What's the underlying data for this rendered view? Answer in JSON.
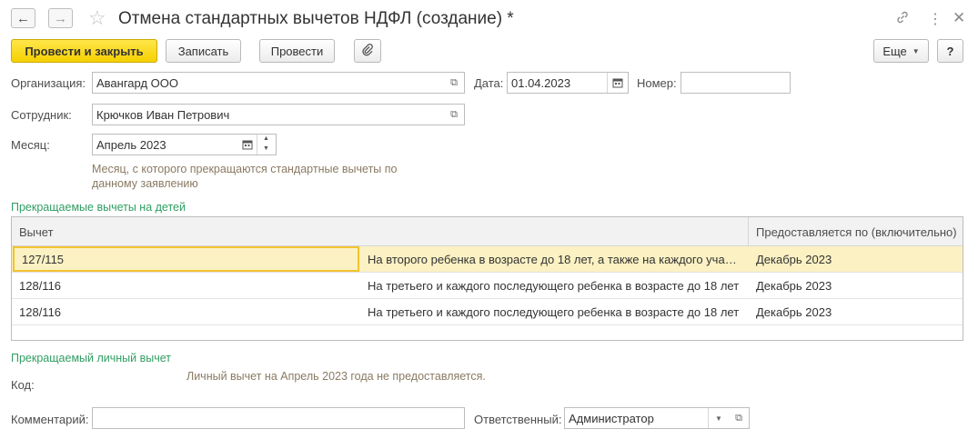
{
  "window": {
    "title": "Отмена стандартных вычетов НДФЛ (создание) *"
  },
  "toolbar": {
    "post_close_label": "Провести и закрыть",
    "save_label": "Записать",
    "post_label": "Провести",
    "more_label": "Еще",
    "help_label": "?"
  },
  "form": {
    "organization_label": "Организация:",
    "organization_value": "Авангард ООО",
    "date_label": "Дата:",
    "date_value": "01.04.2023",
    "number_label": "Номер:",
    "number_value": "",
    "employee_label": "Сотрудник:",
    "employee_value": "Крючков Иван Петрович",
    "month_label": "Месяц:",
    "month_value": "Апрель 2023",
    "month_hint": "Месяц, с которого прекращаются стандартные вычеты по данному заявлению"
  },
  "children_section": {
    "title": "Прекращаемые вычеты на детей",
    "columns": [
      "Вычет",
      "Предоставляется по (включительно)"
    ],
    "rows": [
      {
        "code": "127/115",
        "description": "На второго ребенка в возрасте до 18 лет, а также на каждого учащегося очной формы обучения",
        "until": "Декабрь 2023"
      },
      {
        "code": "128/116",
        "description": "На третьего и каждого последующего ребенка в возрасте до 18 лет",
        "until": "Декабрь 2023"
      },
      {
        "code": "128/116",
        "description": "На третьего и каждого последующего ребенка в возрасте до 18 лет",
        "until": "Декабрь 2023"
      }
    ]
  },
  "personal_section": {
    "title": "Прекращаемый личный вычет",
    "code_label": "Код:",
    "message": "Личный вычет на Апрель 2023 года не предоставляется."
  },
  "footer": {
    "comment_label": "Комментарий:",
    "comment_value": "",
    "responsible_label": "Ответственный:",
    "responsible_value": "Администратор"
  }
}
